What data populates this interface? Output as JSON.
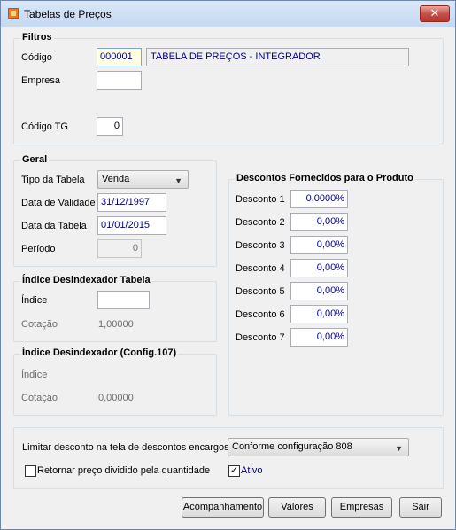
{
  "window": {
    "title": "Tabelas de Preços",
    "close_glyph": "✕",
    "icon": "orange-app-icon"
  },
  "filtros": {
    "title": "Filtros",
    "codigo_label": "Código",
    "codigo_value": "000001",
    "codigo_desc": "TABELA DE PREÇOS - INTEGRADOR",
    "empresa_label": "Empresa",
    "empresa_value": "",
    "codigo_tg_label": "Código TG",
    "codigo_tg_value": "0"
  },
  "geral": {
    "title": "Geral",
    "tipo_label": "Tipo da Tabela",
    "tipo_value": "Venda",
    "validade_label": "Data de Validade",
    "validade_value": "31/12/1997",
    "data_tabela_label": "Data da Tabela",
    "data_tabela_value": "01/01/2015",
    "periodo_label": "Período",
    "periodo_value": "0"
  },
  "indice_tabela": {
    "title": "Índice Desindexador Tabela",
    "indice_label": "Índice",
    "indice_value": "",
    "cotacao_label": "Cotação",
    "cotacao_value": "1,00000"
  },
  "indice_config": {
    "title": "Índice Desindexador (Config.107)",
    "indice_label": "Índice",
    "cotacao_label": "Cotação",
    "cotacao_value": "0,00000"
  },
  "descontos": {
    "title": "Descontos Fornecidos para o Produto",
    "items": [
      {
        "label": "Desconto 1",
        "value": "0,0000%"
      },
      {
        "label": "Desconto 2",
        "value": "0,00%"
      },
      {
        "label": "Desconto 3",
        "value": "0,00%"
      },
      {
        "label": "Desconto 4",
        "value": "0,00%"
      },
      {
        "label": "Desconto 5",
        "value": "0,00%"
      },
      {
        "label": "Desconto 6",
        "value": "0,00%"
      },
      {
        "label": "Desconto 7",
        "value": "0,00%"
      }
    ]
  },
  "opcoes": {
    "limitar_label": "Limitar desconto na tela de descontos encargos",
    "limitar_value": "Conforme configuração 808",
    "retornar_label": "Retornar preço dividido pela quantidade",
    "retornar_checked": false,
    "ativo_label": "Ativo",
    "ativo_checked": true,
    "check_glyph": "✓"
  },
  "buttons": {
    "acompanhamento": "Acompanhamento",
    "valores": "Valores",
    "empresas": "Empresas",
    "sair": "Sair"
  }
}
